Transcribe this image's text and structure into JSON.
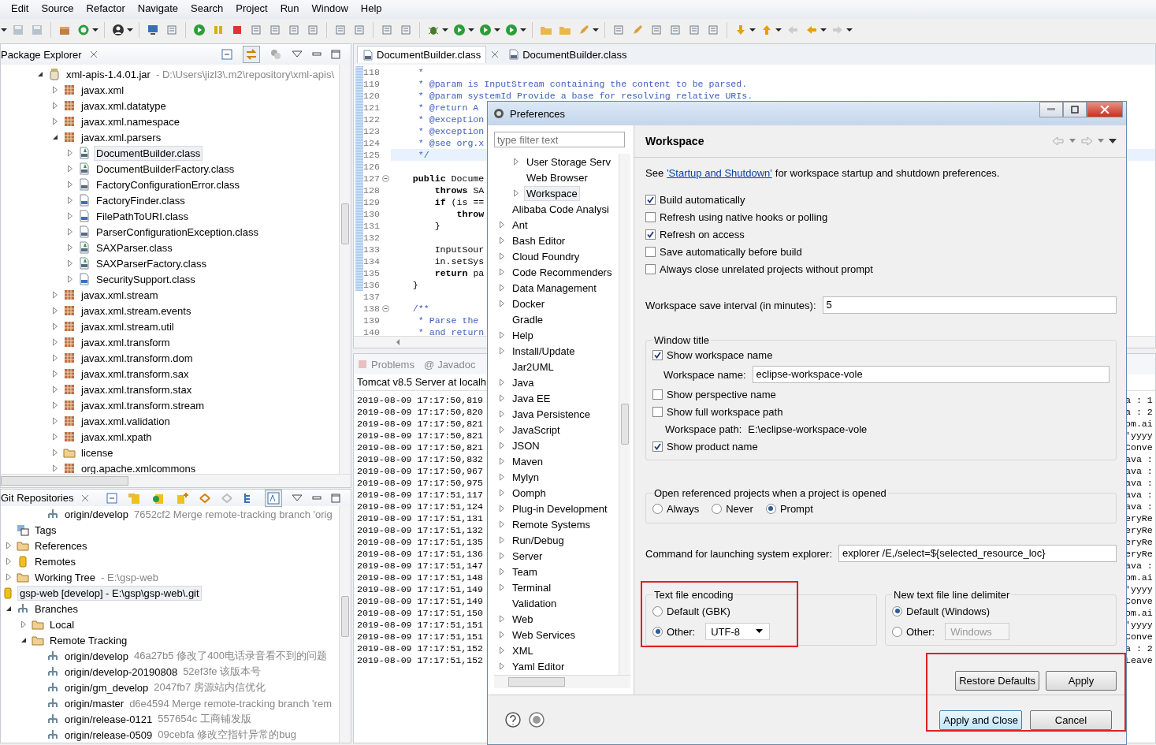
{
  "menu": [
    "Edit",
    "Source",
    "Refactor",
    "Navigate",
    "Search",
    "Project",
    "Run",
    "Window",
    "Help"
  ],
  "package_explorer": {
    "title": "Package Explorer",
    "tree": [
      {
        "label": "xml-apis-1.4.01.jar",
        "detail": "- D:\\Users\\jizl3\\.m2\\repository\\xml-apis\\",
        "kind": "jar",
        "expandable": true,
        "expanded": true,
        "selected": false,
        "children": [
          {
            "label": "javax.xml",
            "kind": "package",
            "expandable": true,
            "expanded": false,
            "selected": false
          },
          {
            "label": "javax.xml.datatype",
            "kind": "package",
            "expandable": true,
            "expanded": false,
            "selected": false
          },
          {
            "label": "javax.xml.namespace",
            "kind": "package",
            "expandable": true,
            "expanded": false,
            "selected": false
          },
          {
            "label": "javax.xml.parsers",
            "kind": "package",
            "expandable": true,
            "expanded": true,
            "selected": false,
            "children": [
              {
                "label": "DocumentBuilder.class",
                "kind": "abstract-class",
                "expandable": true,
                "expanded": false,
                "selected": true
              },
              {
                "label": "DocumentBuilderFactory.class",
                "kind": "abstract-class",
                "expandable": true,
                "expanded": false,
                "selected": false
              },
              {
                "label": "FactoryConfigurationError.class",
                "kind": "class",
                "expandable": true,
                "expanded": false,
                "selected": false
              },
              {
                "label": "FactoryFinder.class",
                "kind": "default-class",
                "expandable": true,
                "expanded": false,
                "selected": false
              },
              {
                "label": "FilePathToURI.class",
                "kind": "default-class",
                "expandable": true,
                "expanded": false,
                "selected": false
              },
              {
                "label": "ParserConfigurationException.class",
                "kind": "class",
                "expandable": true,
                "expanded": false,
                "selected": false
              },
              {
                "label": "SAXParser.class",
                "kind": "abstract-class",
                "expandable": true,
                "expanded": false,
                "selected": false
              },
              {
                "label": "SAXParserFactory.class",
                "kind": "abstract-class",
                "expandable": true,
                "expanded": false,
                "selected": false
              },
              {
                "label": "SecuritySupport.class",
                "kind": "default-class",
                "expandable": true,
                "expanded": false,
                "selected": false
              }
            ]
          },
          {
            "label": "javax.xml.stream",
            "kind": "package",
            "expandable": true,
            "expanded": false,
            "selected": false
          },
          {
            "label": "javax.xml.stream.events",
            "kind": "package",
            "expandable": true,
            "expanded": false,
            "selected": false
          },
          {
            "label": "javax.xml.stream.util",
            "kind": "package",
            "expandable": true,
            "expanded": false,
            "selected": false
          },
          {
            "label": "javax.xml.transform",
            "kind": "package",
            "expandable": true,
            "expanded": false,
            "selected": false
          },
          {
            "label": "javax.xml.transform.dom",
            "kind": "package",
            "expandable": true,
            "expanded": false,
            "selected": false
          },
          {
            "label": "javax.xml.transform.sax",
            "kind": "package",
            "expandable": true,
            "expanded": false,
            "selected": false
          },
          {
            "label": "javax.xml.transform.stax",
            "kind": "package",
            "expandable": true,
            "expanded": false,
            "selected": false
          },
          {
            "label": "javax.xml.transform.stream",
            "kind": "package",
            "expandable": true,
            "expanded": false,
            "selected": false
          },
          {
            "label": "javax.xml.validation",
            "kind": "package",
            "expandable": true,
            "expanded": false,
            "selected": false
          },
          {
            "label": "javax.xml.xpath",
            "kind": "package",
            "expandable": true,
            "expanded": false,
            "selected": false
          },
          {
            "label": "license",
            "kind": "folder",
            "expandable": true,
            "expanded": false,
            "selected": false
          },
          {
            "label": "org.apache.xmlcommons",
            "kind": "package",
            "expandable": true,
            "expanded": false,
            "selected": false
          }
        ]
      }
    ]
  },
  "git_repositories": {
    "title": "Git Repositories",
    "tree": [
      {
        "children": [
          {
            "children": [
              {
                "children": [
                  {
                    "label": "origin/develop",
                    "detail": "7652cf2 Merge remote-tracking branch 'orig",
                    "kind": "branch",
                    "expandable": false,
                    "selected": false
                  }
                ]
              }
            ]
          },
          {
            "label": "Tags",
            "kind": "tags",
            "expandable": false,
            "selected": false
          },
          {
            "label": "References",
            "kind": "folder",
            "expandable": true,
            "expanded": false,
            "selected": false
          },
          {
            "label": "Remotes",
            "kind": "repository",
            "expandable": true,
            "expanded": false,
            "selected": false
          },
          {
            "label": "Working Tree",
            "detail": "- E:\\gsp-web",
            "kind": "folder",
            "expandable": true,
            "expanded": false,
            "selected": false
          }
        ]
      },
      {
        "label": "gsp-web [develop] - E:\\gsp\\gsp-web\\.git",
        "kind": "repository",
        "expandable": false,
        "selected": true,
        "children": [
          {
            "label": "Branches",
            "kind": "branches",
            "expandable": true,
            "expanded": true,
            "selected": false,
            "children": [
              {
                "label": "Local",
                "kind": "folder",
                "expandable": true,
                "expanded": false,
                "selected": false
              },
              {
                "label": "Remote Tracking",
                "kind": "folder",
                "expandable": true,
                "expanded": true,
                "selected": false,
                "children": [
                  {
                    "label": "origin/develop",
                    "detail": "46a27b5 修改了400电话录音看不到的问题",
                    "kind": "branch",
                    "expandable": false,
                    "selected": false
                  },
                  {
                    "label": "origin/develop-20190808",
                    "detail": "52ef3fe 该版本号",
                    "kind": "branch",
                    "expandable": false,
                    "selected": false
                  },
                  {
                    "label": "origin/gm_develop",
                    "detail": "2047fb7 房源站内信优化",
                    "kind": "branch",
                    "expandable": false,
                    "selected": false
                  },
                  {
                    "label": "origin/master",
                    "detail": "d6e4594 Merge remote-tracking branch 'rem",
                    "kind": "branch",
                    "expandable": false,
                    "selected": false
                  },
                  {
                    "label": "origin/release-0121",
                    "detail": "557654c 工商铺发版",
                    "kind": "branch",
                    "expandable": false,
                    "selected": false
                  },
                  {
                    "label": "origin/release-0509",
                    "detail": "09cebfa 修改空指针异常的bug",
                    "kind": "branch",
                    "expandable": false,
                    "selected": false
                  }
                ]
              }
            ]
          }
        ]
      }
    ]
  },
  "editor": {
    "tabs": [
      {
        "label": "DocumentBuilder.class",
        "selected": true
      },
      {
        "label": "DocumentBuilder.class",
        "selected": false
      }
    ],
    "lines": [
      {
        "number": "118",
        "kind": "comment",
        "text": "     *",
        "fold": false,
        "current": false
      },
      {
        "number": "119",
        "kind": "comment",
        "text": "     * @param is InputStream containing the content to be parsed.",
        "fold": false,
        "current": false
      },
      {
        "number": "120",
        "kind": "comment",
        "text": "     * @param systemId Provide a base for resolving relative URIs.",
        "fold": false,
        "current": false
      },
      {
        "number": "121",
        "kind": "comment",
        "text": "     * @return A",
        "fold": false,
        "current": false
      },
      {
        "number": "122",
        "kind": "comment",
        "text": "     * @exception",
        "fold": false,
        "current": false
      },
      {
        "number": "123",
        "kind": "comment",
        "text": "     * @exception",
        "fold": false,
        "current": false
      },
      {
        "number": "124",
        "kind": "comment",
        "text": "     * @see org.x",
        "fold": false,
        "current": false
      },
      {
        "number": "125",
        "kind": "comment",
        "text": "     */",
        "fold": false,
        "current": true
      },
      {
        "number": "126",
        "kind": "code",
        "fold": false,
        "current": false
      },
      {
        "number": "127",
        "kind": "code",
        "text": "    **public** Docume",
        "fold": true,
        "current": false
      },
      {
        "number": "128",
        "kind": "code",
        "text": "        **throws** SA",
        "fold": false,
        "current": false
      },
      {
        "number": "129",
        "kind": "code",
        "text": "        **if** (is ==",
        "fold": false,
        "current": false
      },
      {
        "number": "130",
        "kind": "code",
        "text": "            **throw**",
        "fold": false,
        "current": false
      },
      {
        "number": "131",
        "kind": "code",
        "text": "        }",
        "fold": false,
        "current": false
      },
      {
        "number": "132",
        "kind": "code",
        "fold": false,
        "current": false
      },
      {
        "number": "133",
        "kind": "code",
        "text": "        InputSour",
        "fold": false,
        "current": false
      },
      {
        "number": "134",
        "kind": "code",
        "text": "        in.setSys",
        "fold": false,
        "current": false
      },
      {
        "number": "135",
        "kind": "code",
        "text": "        **return** pa",
        "fold": false,
        "current": false
      },
      {
        "number": "136",
        "kind": "code",
        "text": "    }",
        "fold": false,
        "current": false
      },
      {
        "number": "137",
        "kind": "code",
        "fold": false,
        "current": false
      },
      {
        "number": "138",
        "kind": "comment",
        "text": "    /**",
        "fold": true,
        "current": false
      },
      {
        "number": "139",
        "kind": "comment",
        "text": "     * Parse the",
        "fold": false,
        "current": false
      },
      {
        "number": "140",
        "kind": "comment",
        "text": "     * and return",
        "fold": false,
        "current": false
      }
    ]
  },
  "console": {
    "tabs": [
      {
        "label": "Problems"
      },
      {
        "icon": "@",
        "label": "Javadoc"
      }
    ],
    "title": "Tomcat v8.5 Server at localh",
    "lines": [
      {
        "left": "2019-08-09 17:17:50,819",
        "right": "a : 1"
      },
      {
        "left": "2019-08-09 17:17:50,820",
        "right": "a : 2"
      },
      {
        "left": "2019-08-09 17:17:50,821",
        "right": "om.ai"
      },
      {
        "left": "2019-08-09 17:17:50,821",
        "right": "'yyyy"
      },
      {
        "left": "2019-08-09 17:17:50,821",
        "right": "Conve"
      },
      {
        "left": "2019-08-09 17:17:50,832",
        "right": "ava :"
      },
      {
        "left": "2019-08-09 17:17:50,967",
        "right": "ava :"
      },
      {
        "left": "2019-08-09 17:17:50,975",
        "right": "ava :"
      },
      {
        "left": "2019-08-09 17:17:51,117",
        "right": "ava :"
      },
      {
        "left": "2019-08-09 17:17:51,124",
        "right": "ava :"
      },
      {
        "left": "2019-08-09 17:17:51,131",
        "right": "eryRe"
      },
      {
        "left": "2019-08-09 17:17:51,132",
        "right": "eryRe"
      },
      {
        "left": "2019-08-09 17:17:51,135",
        "right": "eryRe"
      },
      {
        "left": "2019-08-09 17:17:51,136",
        "right": "eryRe"
      },
      {
        "left": "2019-08-09 17:17:51,147",
        "right": "ava :"
      },
      {
        "left": "2019-08-09 17:17:51,148",
        "right": "om.ai"
      },
      {
        "left": "2019-08-09 17:17:51,149",
        "right": "'yyyy"
      },
      {
        "left": "2019-08-09 17:17:51,149",
        "right": "Conve"
      },
      {
        "left": "2019-08-09 17:17:51,150",
        "right": "om.ai"
      },
      {
        "left": "2019-08-09 17:17:51,151",
        "right": "'yyyy"
      },
      {
        "left": "2019-08-09 17:17:51,151",
        "right": "Conve"
      },
      {
        "left": "2019-08-09 17:17:51,152",
        "right": "a : 2"
      },
      {
        "left": "2019-08-09 17:17:51,152",
        "right": "Leave"
      }
    ]
  },
  "preferences": {
    "title": "Preferences",
    "filter_placeholder": "type filter text",
    "tree": [
      {
        "children": [
          {
            "label": "User Storage Serv",
            "expandable": true,
            "expanded": false,
            "selected": false
          },
          {
            "label": "Web Browser",
            "expandable": false,
            "selected": false
          },
          {
            "label": "Workspace",
            "expandable": true,
            "expanded": false,
            "selected": true
          }
        ]
      },
      {
        "label": "Alibaba Code Analysi",
        "expandable": false,
        "selected": false
      },
      {
        "label": "Ant",
        "expandable": true,
        "expanded": false,
        "selected": false
      },
      {
        "label": "Bash Editor",
        "expandable": true,
        "expanded": false,
        "selected": false
      },
      {
        "label": "Cloud Foundry",
        "expandable": true,
        "expanded": false,
        "selected": false
      },
      {
        "label": "Code Recommenders",
        "expandable": true,
        "expanded": false,
        "selected": false
      },
      {
        "label": "Data Management",
        "expandable": true,
        "expanded": false,
        "selected": false
      },
      {
        "label": "Docker",
        "expandable": true,
        "expanded": false,
        "selected": false
      },
      {
        "label": "Gradle",
        "expandable": false,
        "selected": false
      },
      {
        "label": "Help",
        "expandable": true,
        "expanded": false,
        "selected": false
      },
      {
        "label": "Install/Update",
        "expandable": true,
        "expanded": false,
        "selected": false
      },
      {
        "label": "Jar2UML",
        "expandable": false,
        "selected": false
      },
      {
        "label": "Java",
        "expandable": true,
        "expanded": false,
        "selected": false
      },
      {
        "label": "Java EE",
        "expandable": true,
        "expanded": false,
        "selected": false
      },
      {
        "label": "Java Persistence",
        "expandable": true,
        "expanded": false,
        "selected": false
      },
      {
        "label": "JavaScript",
        "expandable": true,
        "expanded": false,
        "selected": false
      },
      {
        "label": "JSON",
        "expandable": true,
        "expanded": false,
        "selected": false
      },
      {
        "label": "Maven",
        "expandable": true,
        "expanded": false,
        "selected": false
      },
      {
        "label": "Mylyn",
        "expandable": true,
        "expanded": false,
        "selected": false
      },
      {
        "label": "Oomph",
        "expandable": true,
        "expanded": false,
        "selected": false
      },
      {
        "label": "Plug-in Development",
        "expandable": true,
        "expanded": false,
        "selected": false
      },
      {
        "label": "Remote Systems",
        "expandable": true,
        "expanded": false,
        "selected": false
      },
      {
        "label": "Run/Debug",
        "expandable": true,
        "expanded": false,
        "selected": false
      },
      {
        "label": "Server",
        "expandable": true,
        "expanded": false,
        "selected": false
      },
      {
        "label": "Team",
        "expandable": true,
        "expanded": false,
        "selected": false
      },
      {
        "label": "Terminal",
        "expandable": true,
        "expanded": false,
        "selected": false
      },
      {
        "label": "Validation",
        "expandable": false,
        "selected": false
      },
      {
        "label": "Web",
        "expandable": true,
        "expanded": false,
        "selected": false
      },
      {
        "label": "Web Services",
        "expandable": true,
        "expanded": false,
        "selected": false
      },
      {
        "label": "XML",
        "expandable": true,
        "expanded": false,
        "selected": false
      },
      {
        "label": "Yaml Editor",
        "expandable": true,
        "expanded": false,
        "selected": false
      }
    ],
    "page": {
      "title": "Workspace",
      "intro_before": "See",
      "link": "'Startup and Shutdown'",
      "intro_after": "for workspace startup and shutdown preferences.",
      "options": [
        {
          "label": "Build automatically",
          "checked": true
        },
        {
          "label": "Refresh using native hooks or polling",
          "checked": false
        },
        {
          "label": "Refresh on access",
          "checked": true
        },
        {
          "label": "Save automatically before build",
          "checked": false
        },
        {
          "label": "Always close unrelated projects without prompt",
          "checked": false
        }
      ],
      "save_interval": {
        "label": "Workspace save interval (in minutes):",
        "value": "5"
      },
      "window_title": {
        "title": "Window title",
        "rows": [
          {
            "kind": "checkbox",
            "label": "Show workspace name",
            "checked": true
          },
          {
            "kind": "field",
            "label": "Workspace name:",
            "value": "eclipse-workspace-vole"
          },
          {
            "kind": "checkbox",
            "label": "Show perspective name",
            "checked": false
          },
          {
            "kind": "checkbox",
            "label": "Show full workspace path",
            "checked": false
          },
          {
            "kind": "text",
            "label": "Workspace path:",
            "value": "E:\\eclipse-workspace-vole"
          },
          {
            "kind": "checkbox",
            "label": "Show product name",
            "checked": true
          }
        ]
      },
      "open_referenced": {
        "title": "Open referenced projects when a project is opened",
        "options": [
          {
            "label": "Always",
            "selected": false
          },
          {
            "label": "Never",
            "selected": false
          },
          {
            "label": "Prompt",
            "selected": true
          }
        ]
      },
      "explorer_command": {
        "label": "Command for launching system explorer:",
        "value": "explorer /E,/select=${selected_resource_loc}"
      },
      "encoding": {
        "title": "Text file encoding",
        "highlighted": true,
        "options": [
          {
            "label": "Default (GBK)",
            "selected": false
          },
          {
            "label": "Other:",
            "selected": true,
            "combo": "UTF-8",
            "disabled": false
          }
        ]
      },
      "line_delimiter": {
        "title": "New text file line delimiter",
        "highlighted": false,
        "options": [
          {
            "label": "Default (Windows)",
            "selected": true
          },
          {
            "label": "Other:",
            "selected": false,
            "combo": "Windows",
            "disabled": true
          }
        ]
      },
      "buttons": [
        "Restore Defaults",
        "Apply"
      ]
    },
    "footer_buttons": [
      {
        "label": "Apply and Close",
        "default": true
      },
      {
        "label": "Cancel",
        "default": false
      }
    ],
    "buttons_highlighted": true
  }
}
